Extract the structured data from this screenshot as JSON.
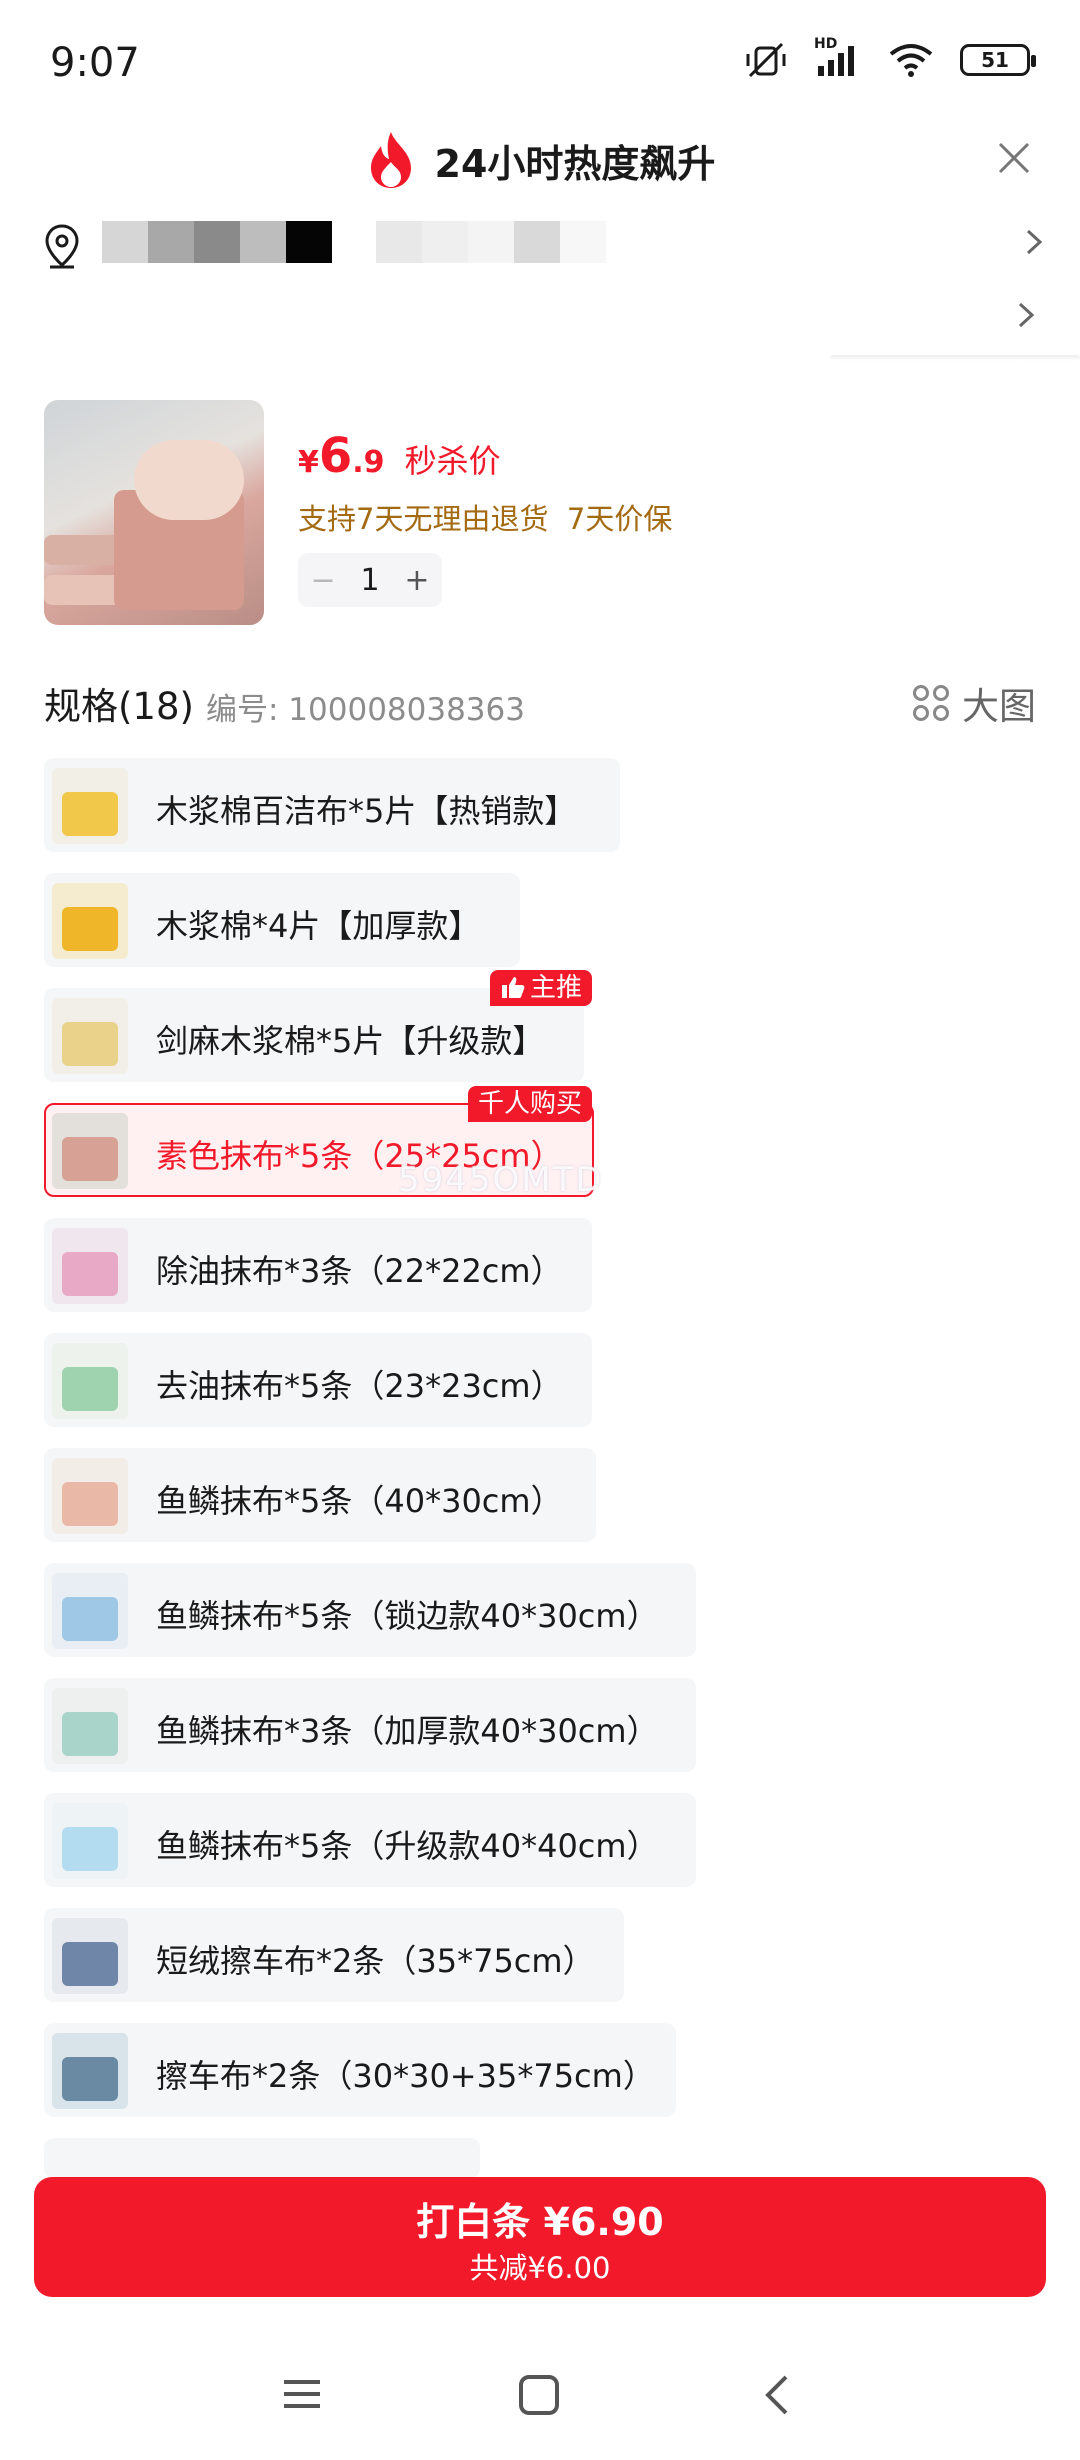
{
  "status_bar": {
    "time": "9:07",
    "network_label": "HD",
    "battery": "51"
  },
  "header": {
    "title": "24小时热度飙升"
  },
  "address": {
    "text": ""
  },
  "product": {
    "price_yen": "¥",
    "price_int": "6",
    "price_dec": ".9",
    "price_label": "秒杀价",
    "guarantee": "支持7天无理由退货  7天价保",
    "stepper": {
      "minus": "−",
      "qty": "1",
      "plus": "+"
    }
  },
  "spec": {
    "title": "规格(18)",
    "id_text": "编号: 100008038363",
    "grid_label": "大图",
    "options": [
      {
        "label": "木浆棉百洁布*5片【热销款】"
      },
      {
        "label": "木浆棉*4片【加厚款】"
      },
      {
        "label": "剑麻木浆棉*5片【升级款】",
        "badge": "主推"
      },
      {
        "label": "素色抹布*5条（25*25cm）",
        "badge": "千人购买",
        "selected": true
      },
      {
        "label": "除油抹布*3条（22*22cm）"
      },
      {
        "label": "去油抹布*5条（23*23cm）"
      },
      {
        "label": "鱼鳞抹布*5条（40*30cm）"
      },
      {
        "label": "鱼鳞抹布*5条（锁边款40*30cm）"
      },
      {
        "label": "鱼鳞抹布*3条（加厚款40*30cm）"
      },
      {
        "label": "鱼鳞抹布*5条（升级款40*40cm）"
      },
      {
        "label": "短绒擦车布*2条（35*75cm）"
      },
      {
        "label": "擦车布*2条（30*30+35*75cm）"
      }
    ]
  },
  "watermark": "5945OMTD",
  "buy_button": {
    "main": "打白条 ¥6.90",
    "sub": "共减¥6.00"
  },
  "colors": {
    "accent": "#f2192a",
    "guarantee": "#a46a12",
    "chip_bg": "#f5f6f8"
  }
}
